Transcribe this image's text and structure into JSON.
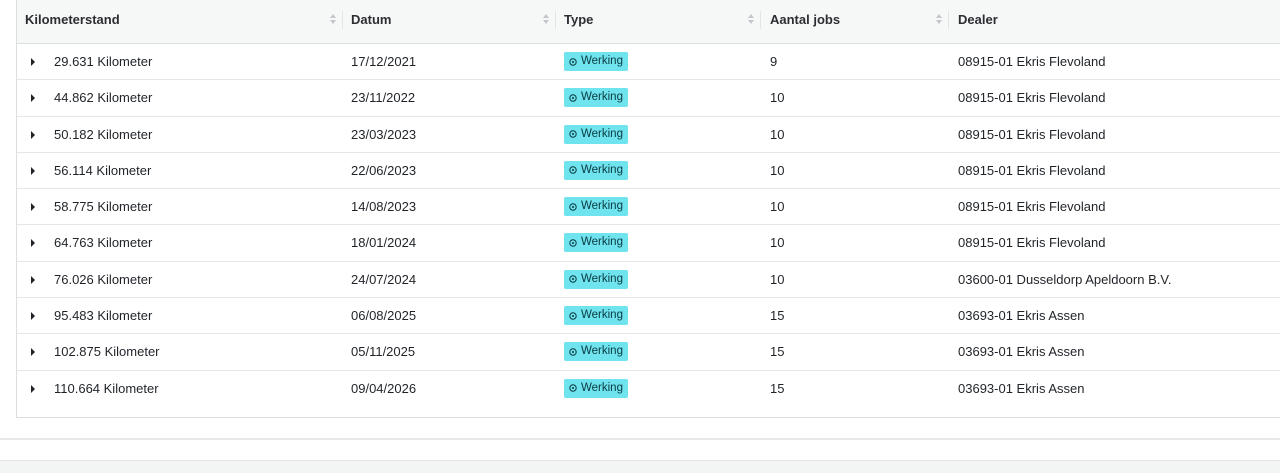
{
  "table": {
    "columns": [
      {
        "label": "Kilometerstand"
      },
      {
        "label": "Datum"
      },
      {
        "label": "Type"
      },
      {
        "label": "Aantal jobs"
      },
      {
        "label": "Dealer"
      }
    ],
    "rows": [
      {
        "km": "29.631 Kilometer",
        "date": "17/12/2021",
        "type": "Werking",
        "jobs": "9",
        "dealer": "08915-01 Ekris Flevoland"
      },
      {
        "km": "44.862 Kilometer",
        "date": "23/11/2022",
        "type": "Werking",
        "jobs": "10",
        "dealer": "08915-01 Ekris Flevoland"
      },
      {
        "km": "50.182 Kilometer",
        "date": "23/03/2023",
        "type": "Werking",
        "jobs": "10",
        "dealer": "08915-01 Ekris Flevoland"
      },
      {
        "km": "56.114 Kilometer",
        "date": "22/06/2023",
        "type": "Werking",
        "jobs": "10",
        "dealer": "08915-01 Ekris Flevoland"
      },
      {
        "km": "58.775 Kilometer",
        "date": "14/08/2023",
        "type": "Werking",
        "jobs": "10",
        "dealer": "08915-01 Ekris Flevoland"
      },
      {
        "km": "64.763 Kilometer",
        "date": "18/01/2024",
        "type": "Werking",
        "jobs": "10",
        "dealer": "08915-01 Ekris Flevoland"
      },
      {
        "km": "76.026 Kilometer",
        "date": "24/07/2024",
        "type": "Werking",
        "jobs": "10",
        "dealer": "03600-01 Dusseldorp Apeldoorn B.V."
      },
      {
        "km": "95.483 Kilometer",
        "date": "06/08/2025",
        "type": "Werking",
        "jobs": "15",
        "dealer": "03693-01 Ekris Assen"
      },
      {
        "km": "102.875 Kilometer",
        "date": "05/11/2025",
        "type": "Werking",
        "jobs": "15",
        "dealer": "03693-01 Ekris Assen"
      },
      {
        "km": "110.664 Kilometer",
        "date": "09/04/2026",
        "type": "Werking",
        "jobs": "15",
        "dealer": "03693-01 Ekris Assen"
      }
    ]
  },
  "icons": {
    "sort": "sort-icon",
    "expand": "caret-right-icon",
    "type_badge": "gear-icon"
  },
  "colors": {
    "badge_background": "#6fe3ee",
    "header_background": "#f6f7f7"
  }
}
